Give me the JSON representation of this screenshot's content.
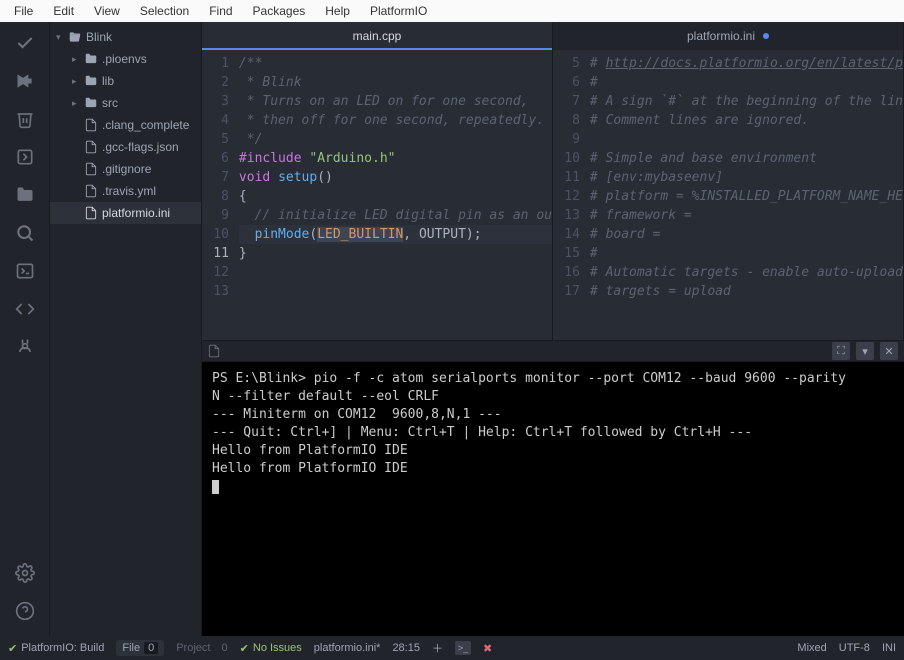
{
  "menu": [
    "File",
    "Edit",
    "View",
    "Selection",
    "Find",
    "Packages",
    "Help",
    "PlatformIO"
  ],
  "tree": {
    "root": "Blink",
    "folders": [
      ".pioenvs",
      "lib",
      "src"
    ],
    "files": [
      ".clang_complete",
      ".gcc-flags.json",
      ".gitignore",
      ".travis.yml",
      "platformio.ini"
    ]
  },
  "tabs": {
    "left": "main.cpp",
    "right": "platformio.ini"
  },
  "editor_left": {
    "start": 1,
    "highlight": 11,
    "lines": [
      {
        "t": "comment",
        "v": "/**"
      },
      {
        "t": "comment",
        "v": " * Blink"
      },
      {
        "t": "comment",
        "v": " * Turns on an LED on for one second,"
      },
      {
        "t": "comment",
        "v": " * then off for one second, repeatedly."
      },
      {
        "t": "comment",
        "v": " */"
      },
      {
        "t": "include",
        "k": "#include",
        "s": "\"Arduino.h\""
      },
      {
        "t": "blank",
        "v": ""
      },
      {
        "t": "func",
        "ret": "void",
        "name": "setup",
        "rest": "()"
      },
      {
        "t": "plain",
        "v": "{"
      },
      {
        "t": "comment",
        "v": "  // initialize LED digital pin as an ou"
      },
      {
        "t": "call",
        "indent": "  ",
        "name": "pinMode",
        "arg1": "LED_BUILTIN",
        "arg2": "OUTPUT",
        "tail": ");"
      },
      {
        "t": "plain",
        "v": "}"
      },
      {
        "t": "blank",
        "v": ""
      }
    ]
  },
  "editor_right": {
    "start": 5,
    "lines": [
      "# http://docs.platformio.org/en/latest/p",
      "#",
      "# A sign `#` at the beginning of the lin",
      "# Comment lines are ignored.",
      "",
      "# Simple and base environment",
      "# [env:mybaseenv]",
      "# platform = %INSTALLED_PLATFORM_NAME_HE",
      "# framework =",
      "# board =",
      "#",
      "# Automatic targets - enable auto-upload",
      "# targets = upload"
    ]
  },
  "terminal": {
    "prompt": "PS E:\\Blink>",
    "cmd": "pio -f -c atom serialports monitor --port COM12 --baud 9600 --parity N --filter default --eol CRLF",
    "lines": [
      "--- Miniterm on COM12  9600,8,N,1 ---",
      "--- Quit: Ctrl+] | Menu: Ctrl+T | Help: Ctrl+T followed by Ctrl+H ---",
      "Hello from PlatformIO IDE",
      "Hello from PlatformIO IDE"
    ]
  },
  "status": {
    "build": "PlatformIO: Build",
    "file_label": "File",
    "file_count": "0",
    "project_label": "Project",
    "project_count": "0",
    "issues": "No Issues",
    "filename": "platformio.ini*",
    "cursor": "28:15",
    "mixed": "Mixed",
    "encoding": "UTF-8",
    "lang": "INI"
  }
}
